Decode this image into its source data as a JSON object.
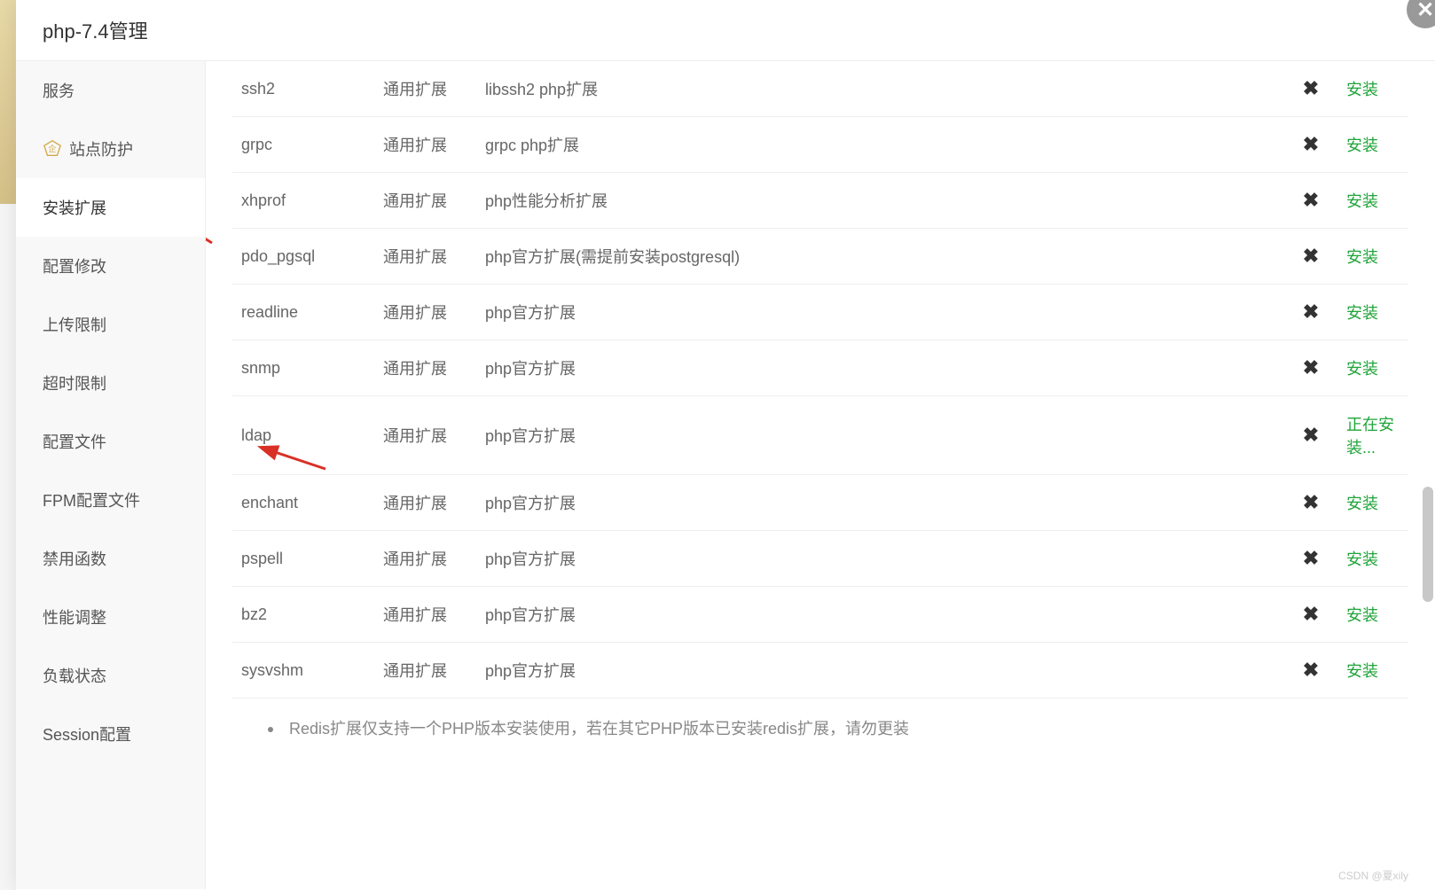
{
  "header": {
    "title": "php-7.4管理"
  },
  "sidebar": {
    "items": [
      {
        "label": "服务",
        "icon": null
      },
      {
        "label": "站点防护",
        "icon": "badge"
      },
      {
        "label": "安装扩展",
        "icon": null,
        "active": true
      },
      {
        "label": "配置修改",
        "icon": null
      },
      {
        "label": "上传限制",
        "icon": null
      },
      {
        "label": "超时限制",
        "icon": null
      },
      {
        "label": "配置文件",
        "icon": null
      },
      {
        "label": "FPM配置文件",
        "icon": null
      },
      {
        "label": "禁用函数",
        "icon": null
      },
      {
        "label": "性能调整",
        "icon": null
      },
      {
        "label": "负载状态",
        "icon": null
      },
      {
        "label": "Session配置",
        "icon": null
      }
    ]
  },
  "table": {
    "install_label": "安装",
    "installing_label": "正在安装...",
    "rows": [
      {
        "name": "ssh2",
        "type": "通用扩展",
        "desc": "libssh2 php扩展",
        "action": "install"
      },
      {
        "name": "grpc",
        "type": "通用扩展",
        "desc": "grpc php扩展",
        "action": "install"
      },
      {
        "name": "xhprof",
        "type": "通用扩展",
        "desc": "php性能分析扩展",
        "action": "install"
      },
      {
        "name": "pdo_pgsql",
        "type": "通用扩展",
        "desc": "php官方扩展(需提前安装postgresql)",
        "action": "install"
      },
      {
        "name": "readline",
        "type": "通用扩展",
        "desc": "php官方扩展",
        "action": "install"
      },
      {
        "name": "snmp",
        "type": "通用扩展",
        "desc": "php官方扩展",
        "action": "install"
      },
      {
        "name": "ldap",
        "type": "通用扩展",
        "desc": "php官方扩展",
        "action": "installing"
      },
      {
        "name": "enchant",
        "type": "通用扩展",
        "desc": "php官方扩展",
        "action": "install"
      },
      {
        "name": "pspell",
        "type": "通用扩展",
        "desc": "php官方扩展",
        "action": "install"
      },
      {
        "name": "bz2",
        "type": "通用扩展",
        "desc": "php官方扩展",
        "action": "install"
      },
      {
        "name": "sysvshm",
        "type": "通用扩展",
        "desc": "php官方扩展",
        "action": "install"
      }
    ]
  },
  "footer": {
    "note": "Redis扩展仅支持一个PHP版本安装使用，若在其它PHP版本已安装redis扩展，请勿更装"
  },
  "watermark": "CSDN @夏xily"
}
